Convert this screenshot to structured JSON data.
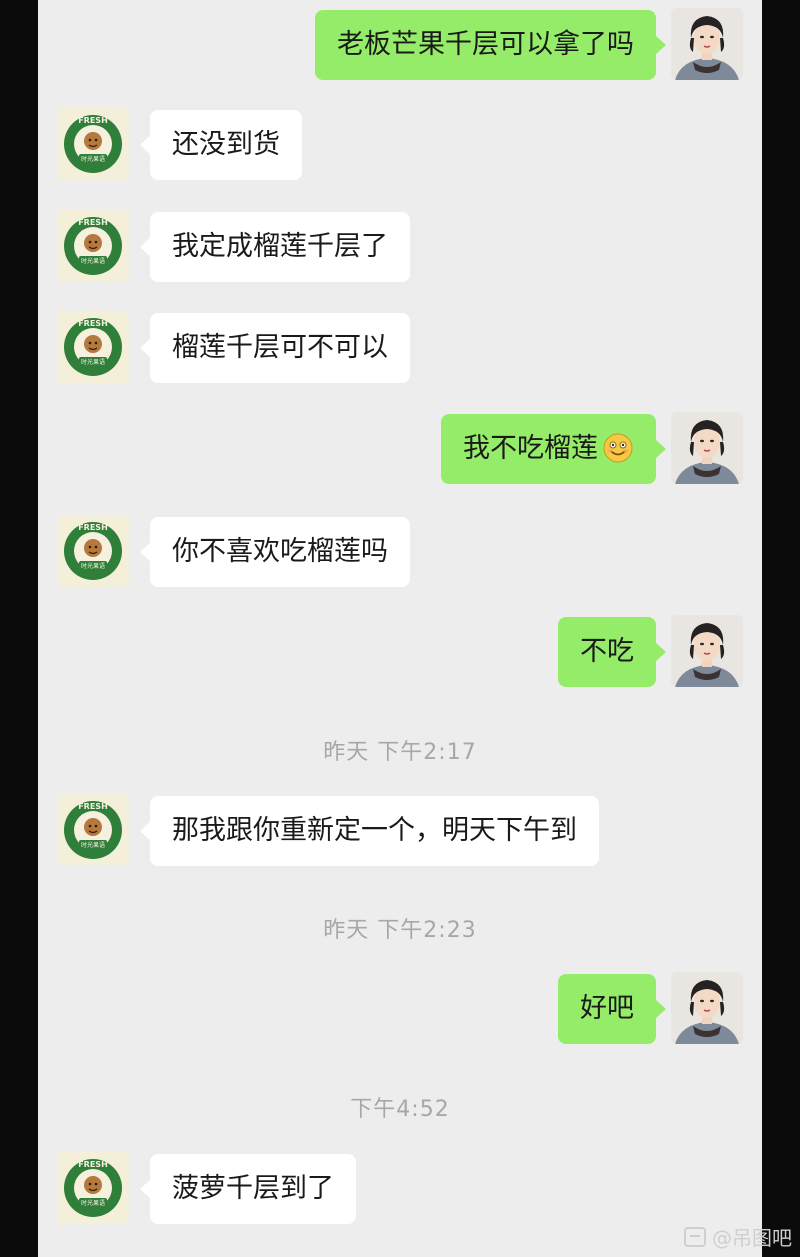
{
  "messages": [
    {
      "side": "right",
      "text": "老板芒果千层可以拿了吗"
    },
    {
      "side": "left",
      "text": "还没到货"
    },
    {
      "side": "left",
      "text": "我定成榴莲千层了"
    },
    {
      "side": "left",
      "text": "榴莲千层可不可以"
    },
    {
      "side": "right",
      "text": "我不吃榴莲",
      "emoji": "smile-emoji"
    },
    {
      "side": "left",
      "text": "你不喜欢吃榴莲吗"
    },
    {
      "side": "right",
      "text": "不吃"
    },
    {
      "side": "left",
      "text": "那我跟你重新定一个，明天下午到"
    },
    {
      "side": "right",
      "text": "好吧"
    },
    {
      "side": "left",
      "text": "菠萝千层到了"
    }
  ],
  "timestamps": [
    "昨天 下午2:17",
    "昨天 下午2:23",
    "下午4:52"
  ],
  "logo": {
    "brand_text": "FRESH",
    "name_text": "时光果语"
  },
  "watermark": {
    "text": "@吊图吧",
    "icon": "comment-icon"
  },
  "colors": {
    "chat_background": "#ededed",
    "outgoing_bubble": "#95ec69",
    "incoming_bubble": "#ffffff",
    "logo_green": "#2f7f3b"
  }
}
